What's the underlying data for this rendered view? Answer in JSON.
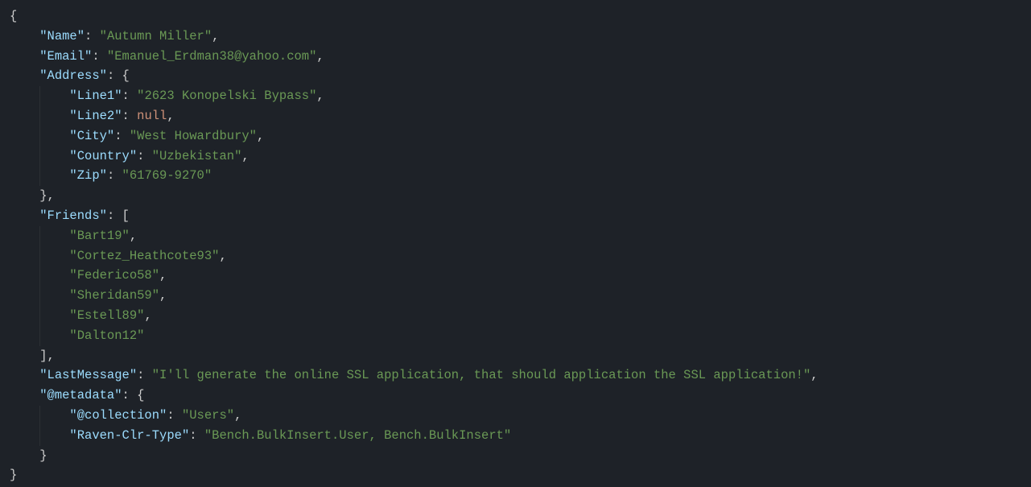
{
  "json_doc": {
    "Name": "Autumn Miller",
    "Email": "Emanuel_Erdman38@yahoo.com",
    "Address": {
      "Line1": "2623 Konopelski Bypass",
      "Line2": null,
      "City": "West Howardbury",
      "Country": "Uzbekistan",
      "Zip": "61769-9270"
    },
    "Friends": [
      "Bart19",
      "Cortez_Heathcote93",
      "Federico58",
      "Sheridan59",
      "Estell89",
      "Dalton12"
    ],
    "LastMessage": "I'll generate the online SSL application, that should application the SSL application!",
    "@metadata": {
      "@collection": "Users",
      "Raven-Clr-Type": "Bench.BulkInsert.User, Bench.BulkInsert"
    }
  },
  "indent_unit": "    ",
  "tokens": {
    "null": "null",
    "open_brace": "{",
    "close_brace": "}",
    "open_bracket": "[",
    "close_bracket": "]",
    "colon": ":",
    "comma": ","
  }
}
